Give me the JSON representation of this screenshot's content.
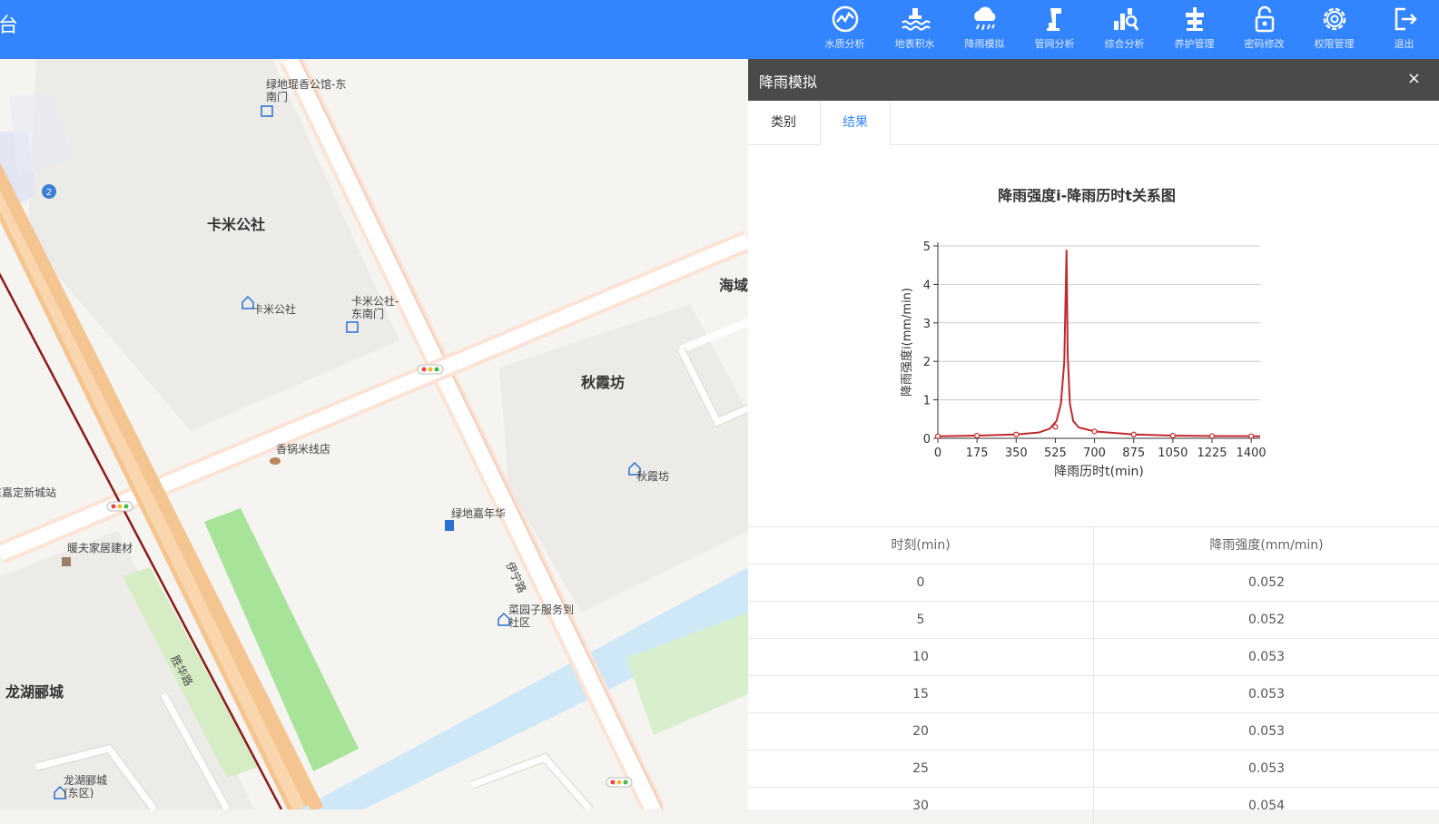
{
  "header": {
    "title_fragment": "台",
    "nav": [
      {
        "label": "水质分析",
        "icon": "water-quality-icon"
      },
      {
        "label": "地表积水",
        "icon": "surface-water-icon"
      },
      {
        "label": "降雨模拟",
        "icon": "rain-cloud-icon"
      },
      {
        "label": "管网分析",
        "icon": "pipe-network-icon"
      },
      {
        "label": "综合分析",
        "icon": "analysis-icon"
      },
      {
        "label": "养护管理",
        "icon": "maintenance-icon"
      },
      {
        "label": "密码修改",
        "icon": "lock-icon"
      },
      {
        "label": "权限管理",
        "icon": "gear-icon"
      },
      {
        "label": "退出",
        "icon": "logout-icon"
      }
    ]
  },
  "map": {
    "labels": {
      "lvdi_east_gate": "绿地琨香公馆-东南门",
      "kami_big": "卡米公社",
      "kami_poi": "卡米公社",
      "kami_gate": "卡米公社-东南门",
      "haiyu": "海域",
      "qiuxiafang_big": "秋霞坊",
      "qiuxiafang_poi": "秋霞坊",
      "noodle": "香锅米线店",
      "jiading_station": "东嘉定新城站",
      "lvdi_carnival": "绿地嘉年华",
      "nuanfu": "暖夫家居建材",
      "road_hb": "胜华路",
      "road_zt": "伊宁路",
      "caiyuan": "菜园子服务到社区",
      "longhu_big": "龙湖郦城",
      "longhu_east": "龙湖郦城(东区)"
    }
  },
  "panel": {
    "title": "降雨模拟",
    "close": "×",
    "tabs": [
      "类别",
      "结果"
    ],
    "active_tab": 1
  },
  "chart_data": {
    "type": "line",
    "title": "降雨强度i-降雨历时t关系图",
    "xlabel": "降雨历时t(min)",
    "ylabel": "降雨强度i(mm/min)",
    "xlim": [
      0,
      1440
    ],
    "ylim": [
      0,
      5
    ],
    "xticks": [
      0,
      175,
      350,
      525,
      700,
      875,
      1050,
      1225,
      1400
    ],
    "yticks": [
      0,
      1,
      2,
      3,
      4,
      5
    ],
    "grid": true,
    "color": "#c0282d",
    "x": [
      0,
      175,
      350,
      450,
      500,
      530,
      550,
      565,
      575,
      580,
      590,
      605,
      630,
      700,
      875,
      1050,
      1225,
      1400,
      1440
    ],
    "y": [
      0.052,
      0.07,
      0.1,
      0.15,
      0.25,
      0.45,
      0.9,
      2.0,
      4.9,
      2.2,
      0.9,
      0.45,
      0.28,
      0.18,
      0.1,
      0.07,
      0.06,
      0.055,
      0.052
    ],
    "markers_x": [
      0,
      175,
      350,
      525,
      700,
      875,
      1050,
      1225,
      1400
    ],
    "markers_y": [
      0.052,
      0.07,
      0.1,
      0.3,
      0.18,
      0.1,
      0.07,
      0.06,
      0.055
    ]
  },
  "table": {
    "headers": [
      "时刻(min)",
      "降雨强度(mm/min)"
    ],
    "rows": [
      [
        "0",
        "0.052"
      ],
      [
        "5",
        "0.052"
      ],
      [
        "10",
        "0.053"
      ],
      [
        "15",
        "0.053"
      ],
      [
        "20",
        "0.053"
      ],
      [
        "25",
        "0.053"
      ],
      [
        "30",
        "0.054"
      ]
    ]
  }
}
